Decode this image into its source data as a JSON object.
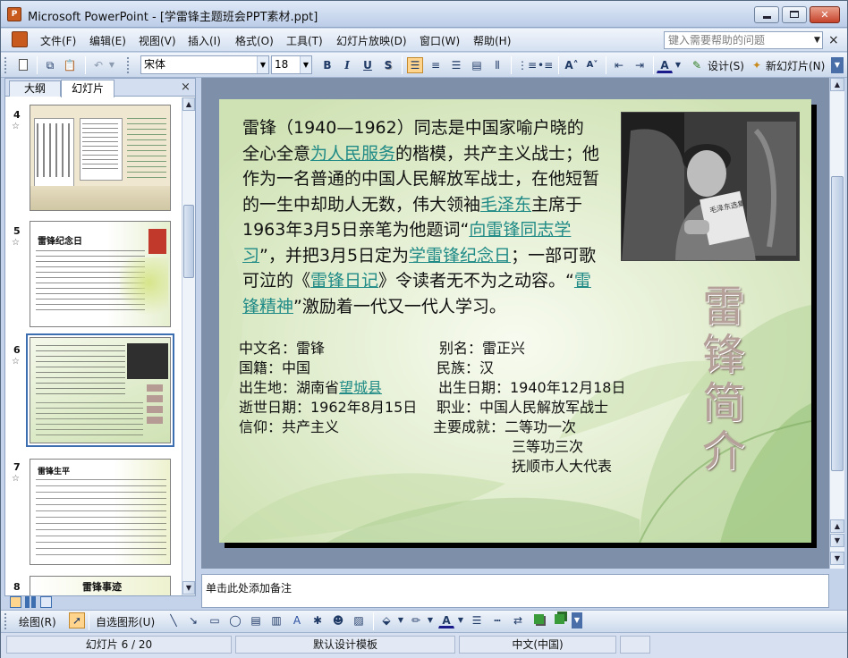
{
  "window": {
    "title": "Microsoft PowerPoint - [学雷锋主题班会PPT素材.ppt]",
    "app_badge": "P",
    "minimize": "0",
    "maximize": "1",
    "close": "r"
  },
  "menu": {
    "items": [
      {
        "label": "文件(F)"
      },
      {
        "label": "编辑(E)"
      },
      {
        "label": "视图(V)"
      },
      {
        "label": "插入(I)"
      },
      {
        "label": "格式(O)"
      },
      {
        "label": "工具(T)"
      },
      {
        "label": "幻灯片放映(D)"
      },
      {
        "label": "窗口(W)"
      },
      {
        "label": "帮助(H)"
      }
    ],
    "help_placeholder": "键入需要帮助的问题",
    "doc_close": "×"
  },
  "toolbar": {
    "font_name": "宋体",
    "font_size": "18",
    "bold": "B",
    "italic": "I",
    "underline": "U",
    "shadow": "S",
    "design_label": "设计(S)",
    "new_slide_label": "新幻灯片(N)"
  },
  "leftpane": {
    "tab_outline": "大纲",
    "tab_slides": "幻灯片",
    "close": "×",
    "thumbnails": [
      {
        "num": "4",
        "caption": ""
      },
      {
        "num": "5",
        "caption": "雷锋纪念日"
      },
      {
        "num": "6",
        "caption": ""
      },
      {
        "num": "7",
        "caption": "雷锋生平"
      },
      {
        "num": "8",
        "caption": "雷锋事迹"
      }
    ]
  },
  "slide": {
    "text_parts": [
      {
        "t": "雷锋（1940—1962）同志是中国家喻户晓的全心全意",
        "link": false
      },
      {
        "t": "为人民服务",
        "link": true
      },
      {
        "t": "的楷模，共产主义战士；他作为一名普通的中国人民解放军战士，在他短暂的一生中却助人无数，伟大领袖",
        "link": false
      },
      {
        "t": "毛泽东",
        "link": true
      },
      {
        "t": "主席于1963年3月5日亲笔为他题词“",
        "link": false
      },
      {
        "t": "向雷锋同志学习",
        "link": true
      },
      {
        "t": "”，并把3月5日定为",
        "link": false
      },
      {
        "t": "学雷锋纪念日",
        "link": true
      },
      {
        "t": "；一部可歌可泣的《",
        "link": false
      },
      {
        "t": "雷锋日记",
        "link": true
      },
      {
        "t": "》令读者无不为之动容。“",
        "link": false
      },
      {
        "t": "雷锋精神",
        "link": true
      },
      {
        "t": "”激励着一代又一代人学习。",
        "link": false
      }
    ],
    "vertical_title": "雷锋简介",
    "photo_book_text": "毛泽东选集",
    "info": {
      "l1": "中文名：雷锋",
      "l2": "国籍：中国",
      "l3_prefix": "出生地：湖南省",
      "l3_link": "望城县",
      "l4": "逝世日期：1962年8月15日",
      "l5": "信仰：共产主义",
      "r1": "别名：雷正兴",
      "r2": "民族：汉",
      "r3": "出生日期：1940年12月18日",
      "r4": "职业：中国人民解放军战士",
      "r5": "主要成就：二等功一次",
      "r6": "三等功三次",
      "r7": "抚顺市人大代表"
    }
  },
  "notes": {
    "placeholder": "单击此处添加备注"
  },
  "drawbar": {
    "draw_label": "绘图(R)",
    "autoshape_label": "自选图形(U)"
  },
  "status": {
    "slide_count": "幻灯片 6 / 20",
    "template": "默认设计模板",
    "language": "中文(中国)"
  },
  "colors": {
    "accent": "#3d6fb0",
    "link": "#1f8a86",
    "slide_bg": "#eaf2dd"
  }
}
